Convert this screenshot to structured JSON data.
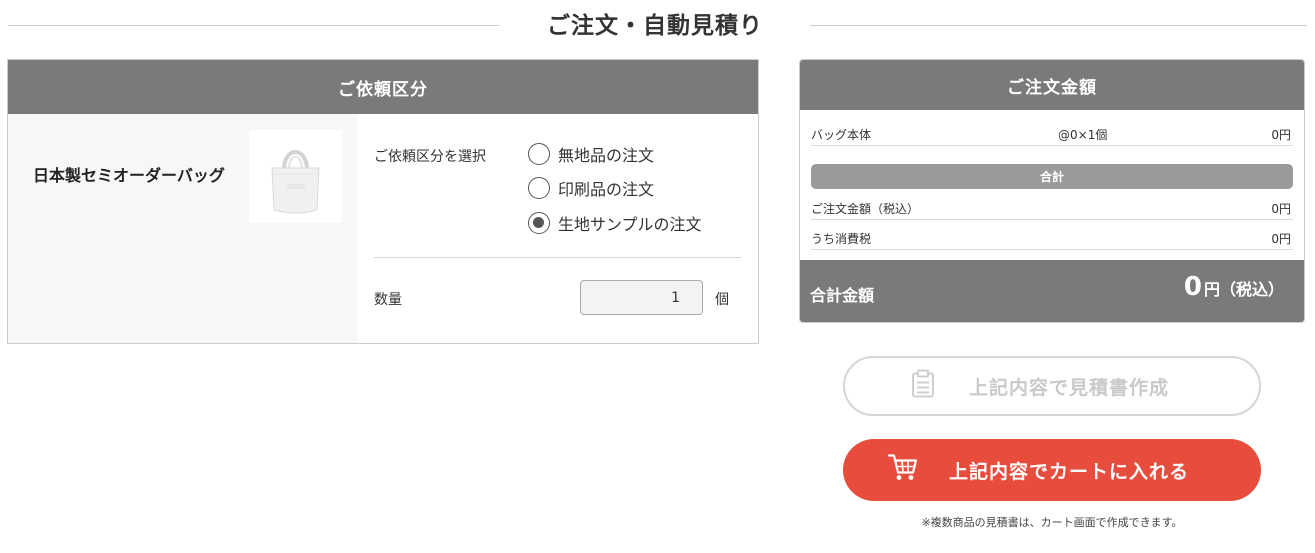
{
  "page": {
    "title": "ご注文・自動見積り"
  },
  "request_panel": {
    "header": "ご依頼区分",
    "product_name": "日本製セミオーダーバッグ",
    "type_label": "ご依頼区分を選択",
    "options": [
      {
        "label": "無地品の注文",
        "checked": false
      },
      {
        "label": "印刷品の注文",
        "checked": false
      },
      {
        "label": "生地サンプルの注文",
        "checked": true
      }
    ],
    "quantity_label": "数量",
    "quantity_value": "1",
    "quantity_unit": "個"
  },
  "summary_panel": {
    "header": "ご注文金額",
    "rows": [
      {
        "label": "バッグ本体",
        "detail": "@0×1個",
        "amount": "0円"
      }
    ],
    "subtotal_header": "合計",
    "subtotal_rows": [
      {
        "label": "ご注文金額（税込）",
        "amount": "0円"
      },
      {
        "label": "うち消費税",
        "amount": "0円"
      }
    ],
    "total_label": "合計金額",
    "total_value": "0",
    "total_suffix": "円（税込）"
  },
  "actions": {
    "estimate_label": "上記内容で見積書作成",
    "cart_label": "上記内容でカートに入れる",
    "note": "※複数商品の見積書は、カート画面で作成できます。"
  },
  "colors": {
    "header_gray": "#7a7a7a",
    "band_gray": "#9a9a9a",
    "cart_red": "#e84c3d",
    "disabled_text": "#c9c9c9"
  },
  "icons": {
    "estimate": "clipboard-icon",
    "cart": "shopping-cart-icon",
    "product": "tote-bag-image"
  }
}
